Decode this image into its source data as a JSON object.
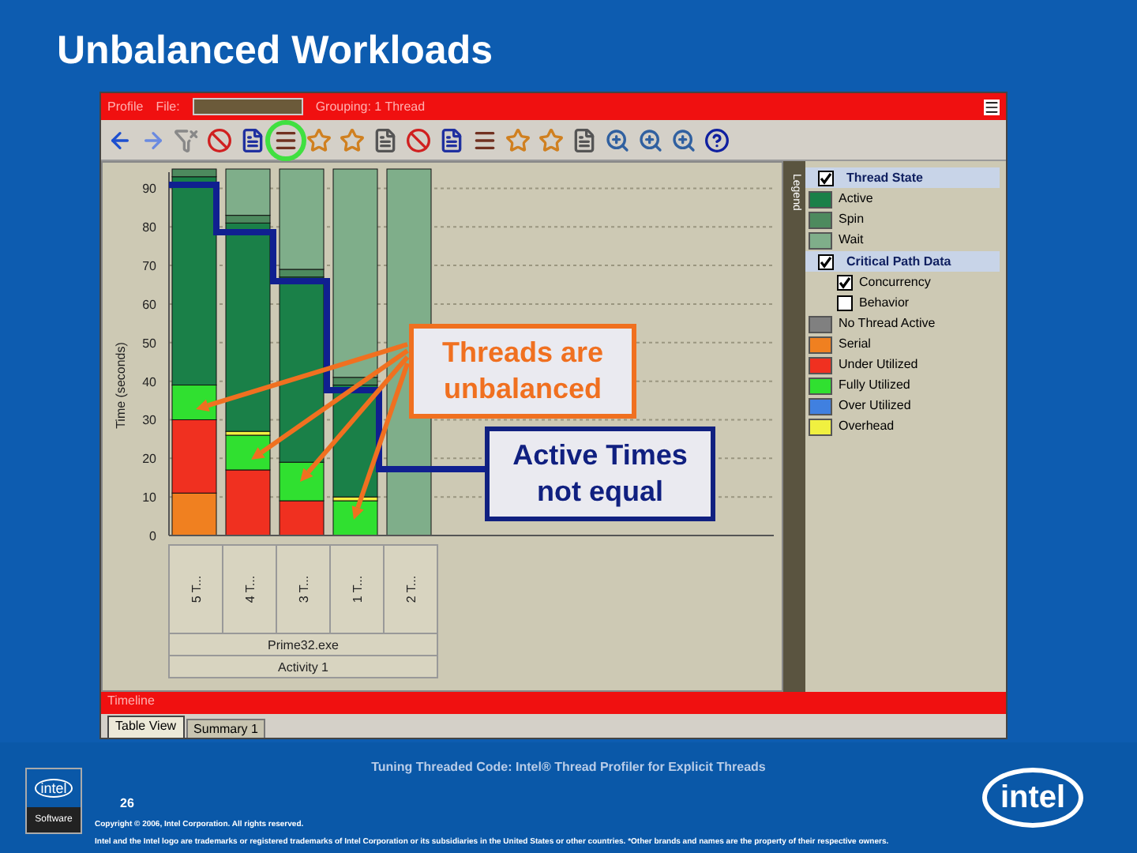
{
  "slide_title": "Unbalanced Workloads",
  "window": {
    "profile_label": "Profile",
    "file_label": "File:",
    "grouping": "Grouping: 1 Thread"
  },
  "toolbar": [
    {
      "kind": "back",
      "highlighted": false
    },
    {
      "kind": "forward",
      "highlighted": false
    },
    {
      "kind": "filter",
      "highlighted": false
    },
    {
      "kind": "block",
      "highlighted": false
    },
    {
      "kind": "bracket",
      "highlighted": false
    },
    {
      "kind": "thread",
      "highlighted": true
    },
    {
      "kind": "star",
      "highlighted": false
    },
    {
      "kind": "star",
      "highlighted": false
    },
    {
      "kind": "doc",
      "highlighted": false
    },
    {
      "kind": "block",
      "highlighted": false
    },
    {
      "kind": "bracket",
      "highlighted": false
    },
    {
      "kind": "thread",
      "highlighted": false
    },
    {
      "kind": "star",
      "highlighted": false
    },
    {
      "kind": "star",
      "highlighted": false
    },
    {
      "kind": "doc",
      "highlighted": false
    },
    {
      "kind": "zoom",
      "highlighted": false
    },
    {
      "kind": "zoom",
      "highlighted": false
    },
    {
      "kind": "zoom",
      "highlighted": false
    },
    {
      "kind": "help",
      "highlighted": false
    }
  ],
  "chart": {
    "chart_data": {
      "type": "bar",
      "stacked": true,
      "grid": true,
      "ylabel": "Time (seconds)",
      "categories": [
        "5 T...",
        "4 T...",
        "3 T...",
        "1 T...",
        "2 T..."
      ],
      "ylim": [
        0,
        95
      ],
      "yticks": [
        0,
        10,
        20,
        30,
        40,
        50,
        60,
        70,
        80,
        90
      ],
      "series": [
        {
          "color": "#f08020",
          "values": [
            11,
            0,
            0,
            0,
            0
          ]
        },
        {
          "color": "#f03020",
          "values": [
            19,
            17,
            9,
            0,
            0
          ]
        },
        {
          "color": "#30e030",
          "values": [
            9,
            9,
            10,
            9,
            0
          ]
        },
        {
          "color": "#f0f040",
          "values": [
            0,
            1,
            0,
            1,
            0
          ]
        },
        {
          "color": "#1a8048",
          "values": [
            54,
            54,
            48,
            29,
            0
          ]
        },
        {
          "color": "#4d8a5e",
          "values": [
            2,
            2,
            2,
            2,
            0
          ]
        },
        {
          "color": "#7fae8a",
          "values": [
            0,
            12,
            26,
            54,
            95
          ]
        }
      ]
    },
    "process": "Prime32.exe",
    "activity": "Activity 1"
  },
  "legend": {
    "tab": "Legend",
    "sections": [
      {
        "title": "Thread State",
        "checked": true,
        "items": [
          {
            "kind": "swatch",
            "label": "Active",
            "color": "#1a8048"
          },
          {
            "kind": "swatch",
            "label": "Spin",
            "color": "#4d8a5e"
          },
          {
            "kind": "swatch",
            "label": "Wait",
            "color": "#7fae8a"
          }
        ]
      },
      {
        "title": "Critical Path Data",
        "checked": true,
        "items": [
          {
            "kind": "checkbox",
            "label": "Concurrency",
            "checked": true
          },
          {
            "kind": "checkbox",
            "label": "Behavior",
            "checked": false
          },
          {
            "kind": "swatch",
            "label": "No Thread Active",
            "color": "#808080"
          },
          {
            "kind": "swatch",
            "label": "Serial",
            "color": "#f08020"
          },
          {
            "kind": "swatch",
            "label": "Under Utilized",
            "color": "#f03020"
          },
          {
            "kind": "swatch",
            "label": "Fully Utilized",
            "color": "#30e030"
          },
          {
            "kind": "swatch",
            "label": "Over Utilized",
            "color": "#4080e0"
          },
          {
            "kind": "swatch",
            "label": "Overhead",
            "color": "#f0f040"
          }
        ]
      }
    ]
  },
  "timeline_label": "Timeline",
  "tabs": [
    {
      "label": "Table View",
      "selected": true
    },
    {
      "label": "Summary 1",
      "selected": false
    }
  ],
  "callouts": [
    {
      "text": "Threads are unbalanced",
      "kind": "orange"
    },
    {
      "text": "Active Times not equal",
      "kind": "blue"
    }
  ],
  "footer": {
    "title": "Tuning Threaded Code: Intel® Thread Profiler for Explicit Threads",
    "page": "26",
    "small_logo": "intel",
    "small_logo_caption": "Software",
    "logo": "intel",
    "copyright": "Copyright © 2006, Intel Corporation. All rights reserved.",
    "trademark": "Intel and the Intel logo are trademarks or registered trademarks of Intel Corporation or its subsidiaries in the United States or other countries. *Other brands and names are the property of their respective owners."
  }
}
